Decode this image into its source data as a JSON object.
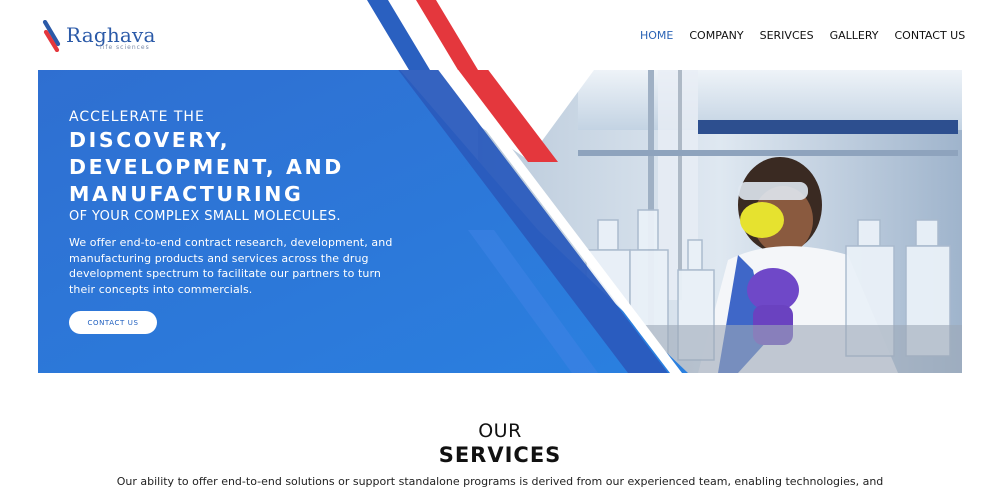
{
  "brand": {
    "name": "Raghava",
    "subtitle": "life sciences",
    "colors": {
      "primary": "#2b5aa8",
      "accent_red": "#e4373d",
      "hero_blue": "#2d74d6"
    }
  },
  "nav": {
    "items": [
      {
        "label": "HOME",
        "active": true
      },
      {
        "label": "COMPANY",
        "active": false
      },
      {
        "label": "SERIVCES",
        "active": false
      },
      {
        "label": "GALLERY",
        "active": false
      },
      {
        "label": "CONTACT US",
        "active": false
      }
    ]
  },
  "hero": {
    "line1": "ACCELERATE THE",
    "line2": "DISCOVERY,",
    "line3": "DEVELOPMENT, AND",
    "line4": "MANUFACTURING",
    "line5": "OF YOUR COMPLEX SMALL MOLECULES.",
    "description": "We offer end-to-end contract research, development, and manufacturing products and services across the drug development spectrum to facilitate our partners to turn their concepts into commercials.",
    "cta_label": "CONTACT US",
    "image_subject": "scientist-in-lab-with-flasks"
  },
  "services": {
    "title_line1": "OUR",
    "title_line2": "SERVICES",
    "description": "Our ability to offer end-to-end solutions or support standalone programs is derived from our experienced team, enabling technologies, and"
  }
}
